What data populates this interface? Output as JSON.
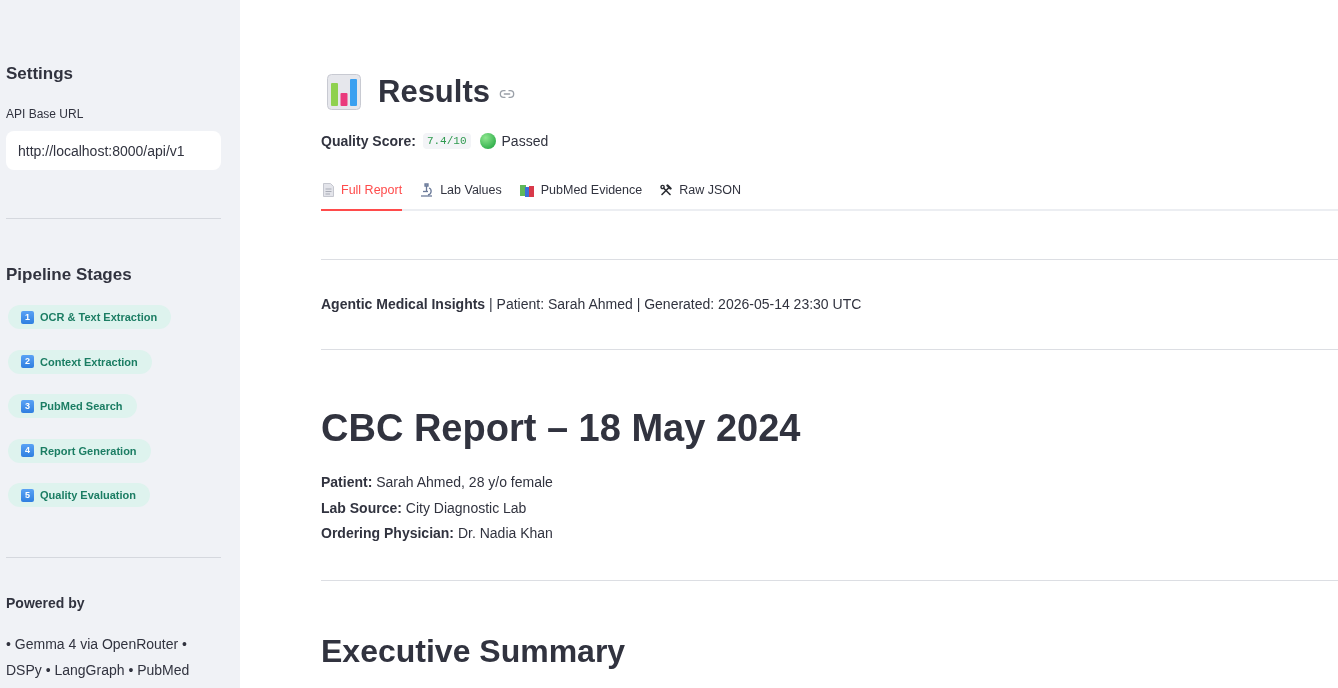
{
  "sidebar": {
    "settings": {
      "title": "Settings",
      "api_base_url": {
        "label": "API Base URL",
        "value": "http://localhost:8000/api/v1"
      }
    },
    "pipeline": {
      "title": "Pipeline Stages",
      "stages": [
        {
          "number": "1",
          "label": "OCR & Text Extraction"
        },
        {
          "number": "2",
          "label": "Context Extraction"
        },
        {
          "number": "3",
          "label": "PubMed Search"
        },
        {
          "number": "4",
          "label": "Report Generation"
        },
        {
          "number": "5",
          "label": "Quality Evaluation"
        }
      ]
    },
    "powered_by": {
      "title": "Powered by",
      "text": "• Gemma 4 via OpenRouter • DSPy • LangGraph • PubMed"
    }
  },
  "main": {
    "title": "Results",
    "quality": {
      "label": "Quality Score:",
      "score": "7.4/10",
      "status": "Passed"
    },
    "tabs": [
      {
        "label": "Full Report",
        "selected": true
      },
      {
        "label": "Lab Values",
        "selected": false
      },
      {
        "label": "PubMed Evidence",
        "selected": false
      },
      {
        "label": "Raw JSON",
        "selected": false
      }
    ],
    "report": {
      "meta": "**Agentic Medical Insights** | Patient: Sarah Ahmed | Generated: 2026-05-14 23:30 UTC",
      "heading": "CBC Report – 18 May 2024",
      "details": [
        "**Patient:** Sarah Ahmed, 28 y/o female",
        "**Lab Source:** City Diagnostic Lab",
        "**Ordering Physician:** Dr. Nadia Khan"
      ],
      "section_heading": "Executive Summary"
    }
  }
}
